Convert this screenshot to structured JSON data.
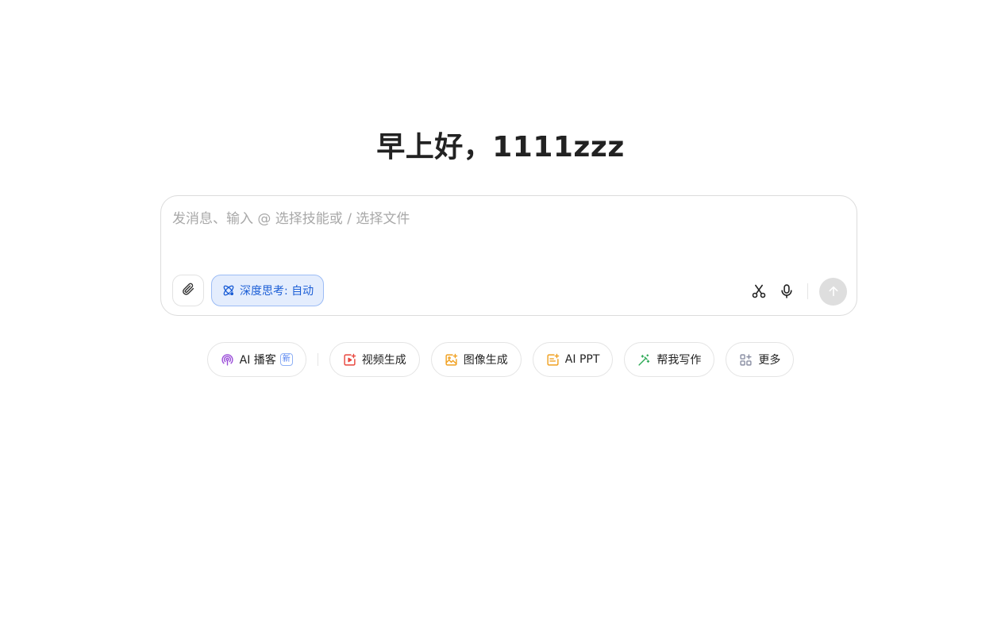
{
  "greeting": "早上好，1111zzz",
  "composer": {
    "placeholder": "发消息、输入 @ 选择技能或 / 选择文件",
    "value": "",
    "deep_think_label": "深度思考: 自动"
  },
  "icons": {
    "attach": "paperclip-icon",
    "deep_think": "atom-icon",
    "scissor": "scissors-icon",
    "mic": "microphone-icon",
    "send": "arrow-up-icon"
  },
  "skills": [
    {
      "label": "AI 播客",
      "badge": "新",
      "icon": "podcast-icon",
      "color": "#9b4fd9"
    },
    {
      "label": "视频生成",
      "icon": "video-icon",
      "color": "#e8453c"
    },
    {
      "label": "图像生成",
      "icon": "image-icon",
      "color": "#f0a020"
    },
    {
      "label": "AI PPT",
      "icon": "ppt-icon",
      "color": "#f0a020"
    },
    {
      "label": "帮我写作",
      "icon": "pen-icon",
      "color": "#2faa57"
    },
    {
      "label": "更多",
      "icon": "grid-icon",
      "color": "#8a8fa3"
    }
  ],
  "colors": {
    "accent_blue": "#1d5fd6",
    "deep_think_bg": "#e4edfd",
    "send_disabled": "#dedede"
  }
}
